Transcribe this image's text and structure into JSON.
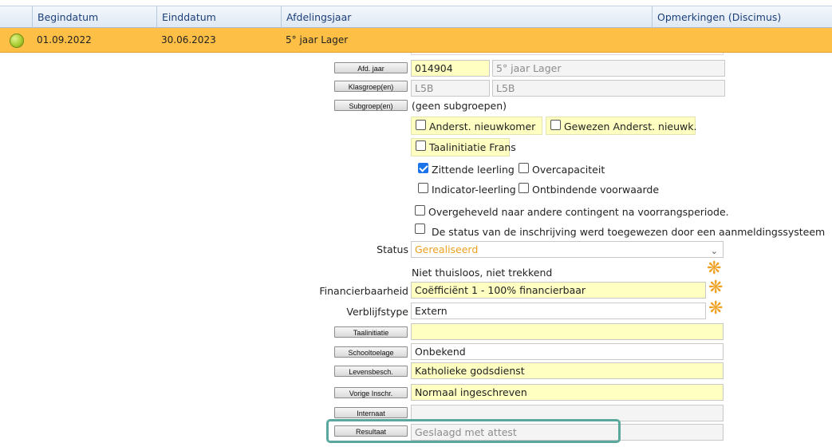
{
  "grid": {
    "columns": [
      "Begindatum",
      "Einddatum",
      "Afdelingsjaar",
      "Opmerkingen (Discimus)"
    ],
    "row": {
      "begindatum": "01.09.2022",
      "einddatum": "30.06.2023",
      "afdelingsjaar": "5° jaar Lager",
      "status_color": "#a5c92c"
    }
  },
  "form": {
    "afd_jaar": {
      "button": "Afd. jaar",
      "code": "014904",
      "name": "5° jaar Lager"
    },
    "klasgroep": {
      "button": "Klasgroep(en)",
      "value1": "L5B",
      "value2": "L5B"
    },
    "subgroep": {
      "button": "Subgroep(en)",
      "text": "(geen subgroepen)"
    },
    "checkboxes": {
      "anderst_nieuwkomer": {
        "label": "Anderst. nieuwkomer",
        "checked": false
      },
      "gewezen_anderst": {
        "label": "Gewezen Anderst. nieuwk.",
        "checked": false
      },
      "taalinitiatie_frans": {
        "label": "Taalinitiatie Frans",
        "checked": false
      },
      "zittende_leerling": {
        "label": "Zittende leerling",
        "checked": true
      },
      "overcapaciteit": {
        "label": "Overcapaciteit",
        "checked": false
      },
      "indicator_leerling": {
        "label": "Indicator-leerling",
        "checked": false
      },
      "ontbindende_voorwaarde": {
        "label": "Ontbindende voorwaarde",
        "checked": false
      },
      "overgeheveld": {
        "label": "Overgeheveld naar andere contingent na voorrangsperiode.",
        "checked": false
      },
      "aanmeldingssysteem": {
        "label": "De status van de inschrijving werd toegewezen door een aanmeldingssysteem",
        "checked": false
      }
    },
    "status": {
      "label": "Status",
      "value": "Gerealiseerd"
    },
    "thuisloos_text": "Niet thuisloos, niet trekkend",
    "financierbaarheid": {
      "label": "Financierbaarheid",
      "value": "Coëfficiënt 1 - 100% financierbaar"
    },
    "verblijfstype": {
      "label": "Verblijfstype",
      "value": "Extern"
    },
    "taalinitiatie": {
      "button": "Taalinitiatie",
      "value": ""
    },
    "schooltoelage": {
      "button": "Schooltoelage",
      "value": "Onbekend"
    },
    "levensbesch": {
      "button": "Levensbesch.",
      "value": "Katholieke godsdienst"
    },
    "vorige_inschr": {
      "button": "Vorige Inschr.",
      "value": "Normaal ingeschreven"
    },
    "internaat": {
      "button": "Internaat",
      "value": ""
    },
    "resultaat": {
      "button": "Resultaat",
      "value": "Geslaagd met attest"
    }
  },
  "colors": {
    "header_text": "#1b3f7a",
    "row_highlight": "#fdbf45",
    "status_text": "#f0a020",
    "field_yellow": "#ffffc2",
    "focus_outline": "#5aa89c"
  },
  "icons": {
    "required": "asterisk-icon",
    "dropdown": "chevron-down-icon"
  }
}
